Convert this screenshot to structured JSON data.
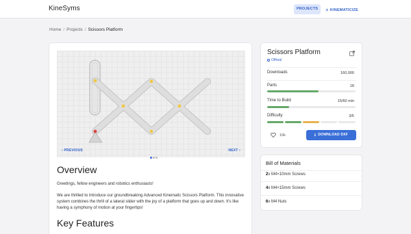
{
  "header": {
    "brand": "KineSyms",
    "nav": {
      "projects": "PROJECTS",
      "kinematicize": "KINEMATICIZE"
    }
  },
  "breadcrumb": {
    "home": "Home",
    "projects": "Projects",
    "current": "Scissors Platform"
  },
  "viewer": {
    "prev": "PREVIOUS",
    "next": "NEXT",
    "slide_count": 3,
    "active_slide": 1
  },
  "content": {
    "overview_title": "Overview",
    "para1": "Greetings, fellow engineers and robotics enthusiasts!",
    "para2": "We are thrilled to introduce our groundbreaking Advanced Kinematic Scissors Platform. This innovative system combines the thrill of a lateral slider with the joy of a platform that goes up and down. It's like having a symphony of motion at your fingertips!",
    "features_title": "Key Features"
  },
  "info": {
    "title": "Scissors Platform",
    "badge": "Official",
    "downloads_label": "Downloads",
    "downloads_value": "160,000",
    "parts_label": "Parts",
    "parts_value": "18",
    "parts_fraction": 0.58,
    "time_label": "Time to Build",
    "time_value": "15/60 min",
    "time_fraction": 0.25,
    "difficulty_label": "Difficulty",
    "difficulty_value": "3/5",
    "likes": "10k",
    "download_label": "DOWNLOAD DXF"
  },
  "bom": {
    "title": "Bill of Materials",
    "items": [
      {
        "qty": "2",
        "text": "x M4×10mm Screws"
      },
      {
        "qty": "4",
        "text": "x M4×15mm Screws"
      },
      {
        "qty": "6",
        "text": "x M4 Nuts"
      }
    ]
  },
  "colors": {
    "accent": "#3a6fd8",
    "bar_green": "#66a868",
    "difficulty_orange": "#e8b24e",
    "joint_yellow": "#f2c744",
    "joint_red": "#d9443c"
  }
}
